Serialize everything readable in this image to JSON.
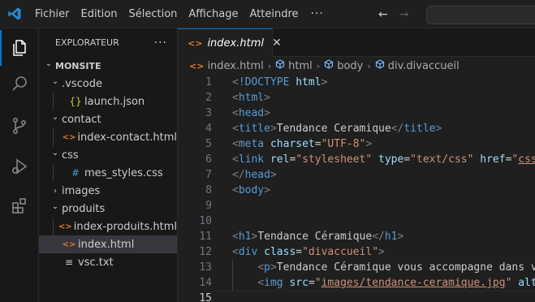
{
  "menu": [
    "Fichier",
    "Edition",
    "Sélection",
    "Affichage",
    "Atteindre"
  ],
  "menu_more": "···",
  "nav": {
    "back": "←",
    "forward": "→"
  },
  "sidebar": {
    "title": "EXPLORATEUR",
    "more": "···",
    "items": [
      {
        "label": "MONSITE",
        "chev": "⌄",
        "icon": "",
        "icon_color": "#cccccc"
      },
      {
        "label": ".vscode",
        "chev": "⌄",
        "icon": "",
        "icon_color": "#cccccc"
      },
      {
        "label": "launch.json",
        "chev": "",
        "icon": "{}",
        "icon_color": "#cbcb41"
      },
      {
        "label": "contact",
        "chev": "⌄",
        "icon": "",
        "icon_color": "#cccccc"
      },
      {
        "label": "index-contact.html",
        "chev": "",
        "icon": "<>",
        "icon_color": "#e37933"
      },
      {
        "label": "css",
        "chev": "⌄",
        "icon": "",
        "icon_color": "#cccccc"
      },
      {
        "label": "mes_styles.css",
        "chev": "",
        "icon": "#",
        "icon_color": "#519aba"
      },
      {
        "label": "images",
        "chev": "›",
        "icon": "",
        "icon_color": "#cccccc"
      },
      {
        "label": "produits",
        "chev": "⌄",
        "icon": "",
        "icon_color": "#cccccc"
      },
      {
        "label": "index-produits.html",
        "chev": "",
        "icon": "<>",
        "icon_color": "#e37933"
      },
      {
        "label": "index.html",
        "chev": "",
        "icon": "<>",
        "icon_color": "#e37933"
      },
      {
        "label": "vsc.txt",
        "chev": "",
        "icon": "≡",
        "icon_color": "#cccccc"
      }
    ]
  },
  "tab": {
    "label": "index.html",
    "icon": "<>",
    "close": "✕"
  },
  "breadcrumb": [
    "index.html",
    "html",
    "body",
    "div.divaccueil"
  ],
  "editor": {
    "line_numbers": [
      "1",
      "2",
      "3",
      "4",
      "5",
      "6",
      "7",
      "8",
      "9",
      "10",
      "11",
      "12",
      "13",
      "14",
      "15"
    ],
    "current_line": "15",
    "lines": [
      "<!DOCTYPE html>",
      "<html>",
      "<head>",
      "<title>Tendance Ceramique</title>",
      "<meta charset=\"UTF-8\">",
      "<link rel=\"stylesheet\" type=\"text/css\" href=\"css/",
      "</head>",
      "<body>",
      "",
      "",
      "<h1>Tendance Céramique</h1>",
      "<div class=\"divaccueil\">",
      "    <p>Tendance Céramique vous accompagne dans vo",
      "    <img src=\"images/tendance-ceramique.jpg\" alt=",
      ""
    ]
  },
  "colors": {
    "accent": "#0078d4",
    "background": "#1f1f1f",
    "sidebar": "#181818",
    "tag": "#569cd6",
    "attribute": "#9cdcfe",
    "string": "#ce9178"
  }
}
